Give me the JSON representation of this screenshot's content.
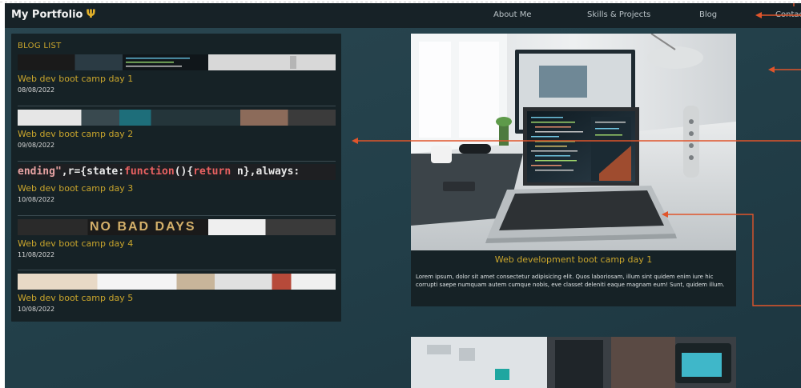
{
  "navbar": {
    "brand": "My Portfolio",
    "brand_icon": "trident-icon",
    "links": [
      {
        "label": "About Me"
      },
      {
        "label": "Skills & Projects"
      },
      {
        "label": "Blog"
      },
      {
        "label": "Contact"
      }
    ]
  },
  "blog_list": {
    "title": "BLOG LIST",
    "items": [
      {
        "title": "Web dev boot camp day 1",
        "date": "08/08/2022"
      },
      {
        "title": "Web dev boot camp day 2",
        "date": "09/08/2022"
      },
      {
        "title": "Web dev boot camp day 3",
        "date": "10/08/2022",
        "code": "ending\",r={state:function(){return n},always:"
      },
      {
        "title": "Web dev boot camp day 4",
        "date": "11/08/2022",
        "sign": "NO BAD DAYS"
      },
      {
        "title": "Web dev boot camp day 5",
        "date": "10/08/2022"
      }
    ]
  },
  "featured": {
    "title": "Web development boot camp day 1",
    "body": "Lorem ipsum, dolor sit amet consectetur adipisicing elit. Quos laboriosam, illum sint quidem enim iure hic corrupti saepe numquam autem cumque nobis, eve classet deleniti eaque magnam eum! Sunt, quidem illum."
  },
  "colors": {
    "navbar_bg": "#172227",
    "page_bg": "#23404a",
    "accent": "#c9a52c",
    "annotation": "#e0552b"
  }
}
